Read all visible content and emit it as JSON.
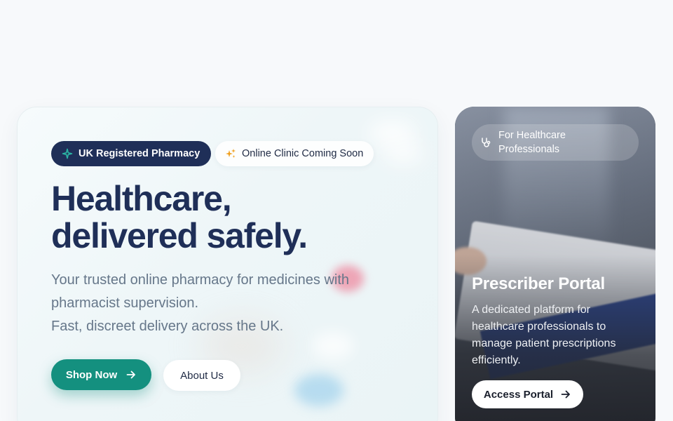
{
  "hero": {
    "badge_registered": "UK Registered Pharmacy",
    "badge_clinic": "Online Clinic Coming Soon",
    "headline": [
      "Healthcare,",
      "delivered safely."
    ],
    "subtitle": [
      "Your trusted online pharmacy for medicines with",
      "pharmacist supervision.",
      "Fast, discreet delivery across the UK."
    ],
    "shop_button": "Shop Now",
    "about_button": "About Us"
  },
  "portal": {
    "pill_label": "For Healthcare Professionals",
    "title": "Prescriber Portal",
    "description": [
      "A dedicated platform for",
      "healthcare professionals to",
      "manage patient prescriptions",
      "efficiently."
    ],
    "access_button": "Access Portal"
  },
  "icons": {
    "registered": "sparkle-pulse-icon",
    "clinic": "sparkles-icon",
    "shop_arrow": "arrow-right-icon",
    "pro": "stethoscope-icon",
    "access_arrow": "arrow-right-icon"
  },
  "colors": {
    "brand_navy": "#1f2f58",
    "brand_teal": "#14907f",
    "background": "#f7f9fb",
    "muted_text": "#66778a",
    "clinic_icon": "#f0a020",
    "registered_icon": "#2bb3a3"
  }
}
